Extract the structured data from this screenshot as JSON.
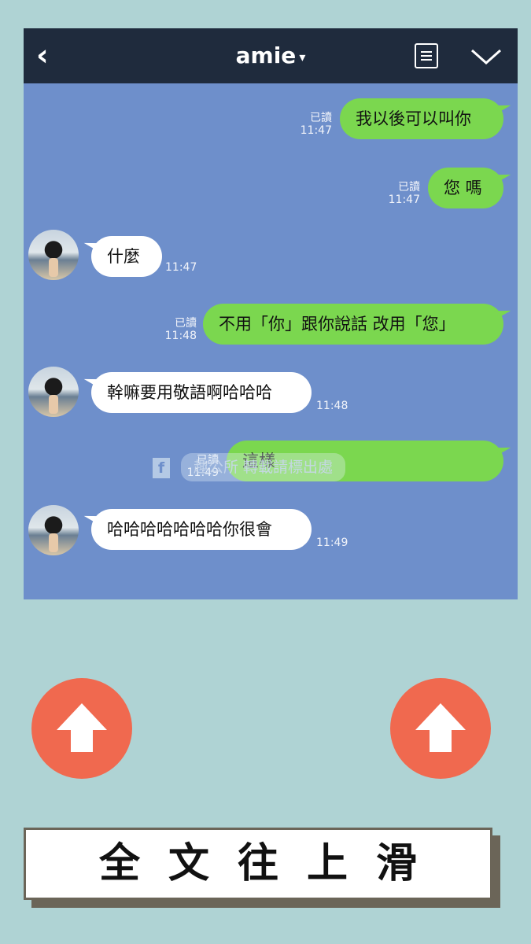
{
  "header": {
    "back_icon": "‹",
    "title": "amie",
    "title_caret": "▾"
  },
  "messages": [
    {
      "dir": "out",
      "text": "我以後可以叫你",
      "read": "已讀",
      "time": "11:47"
    },
    {
      "dir": "out",
      "text": "您 嗎",
      "read": "已讀",
      "time": "11:47"
    },
    {
      "dir": "in",
      "text": "什麼",
      "time": "11:47"
    },
    {
      "dir": "out",
      "text": "不用「你」跟你說話 改用「您」",
      "read": "已讀",
      "time": "11:48"
    },
    {
      "dir": "in",
      "text": "幹嘛要用敬語啊哈哈哈",
      "time": "11:48"
    },
    {
      "dir": "out",
      "text": "這樣",
      "read": "已讀",
      "time": "11:49"
    },
    {
      "dir": "in",
      "text": "哈哈哈哈哈哈哈你很會",
      "time": "11:49"
    }
  ],
  "watermark": {
    "fb_letter": "f",
    "text": "趣公所 轉載請標出處"
  },
  "footer": {
    "banner_text": "全文往上滑"
  },
  "colors": {
    "page_bg": "#afd3d4",
    "chat_bg": "#6e8fcb",
    "header_bg": "#1f2b3d",
    "outgoing_bubble": "#7bd74f",
    "incoming_bubble": "#ffffff",
    "up_button": "#f0694f"
  },
  "icons": {
    "back": "chevron-left-icon",
    "menu": "list-menu-icon",
    "collapse": "chevron-down-icon",
    "scroll_up": "arrow-up-icon"
  }
}
